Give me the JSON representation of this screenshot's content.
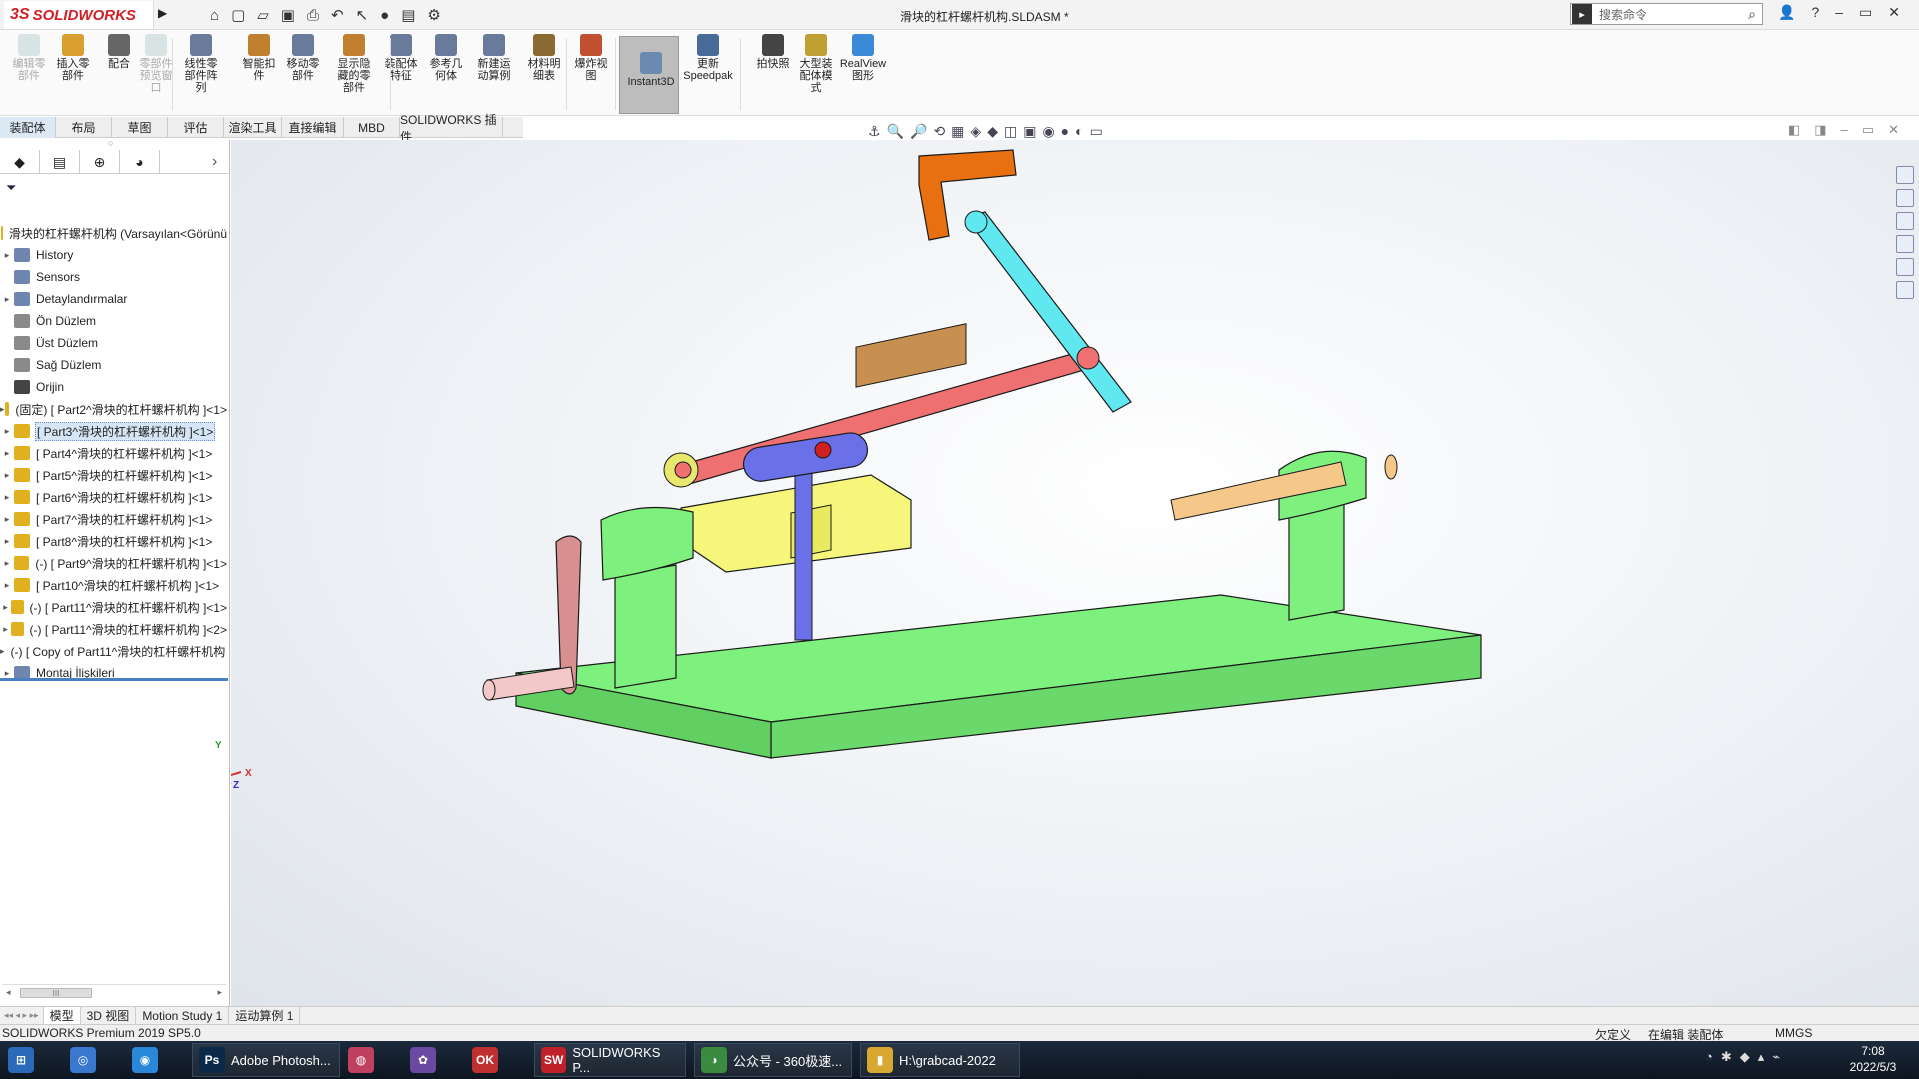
{
  "app": {
    "brand": "SOLIDWORKS",
    "brand_mark": "3S",
    "document_title": "滑块的杠杆螺杆机构.SLDASM *",
    "search_placeholder": "搜索命令",
    "qa_arrow": "▶",
    "qa_icons": [
      "⌂",
      "▢",
      "▱",
      "▣",
      "⎙",
      "↶",
      "↖",
      "●",
      "▤",
      "⚙"
    ],
    "right_icons": [
      "👤",
      "?",
      "–",
      "▭",
      "✕"
    ]
  },
  "commands": [
    {
      "label": "编辑零部件",
      "disabled": true
    },
    {
      "label": "插入零部件"
    },
    {
      "label": "配合"
    },
    {
      "label": "零部件预览窗口",
      "disabled": true
    },
    {
      "label": "线性零部件阵列"
    },
    {
      "label": "智能扣件"
    },
    {
      "label": "移动零部件"
    },
    {
      "label": "显示隐藏的零部件"
    },
    {
      "label": "装配体特征"
    },
    {
      "label": "参考几何体"
    },
    {
      "label": "新建运动算例"
    },
    {
      "label": "材料明细表"
    },
    {
      "label": "爆炸视图"
    },
    {
      "label": "Instant3D"
    },
    {
      "label": "更新Speedpak"
    },
    {
      "label": "拍快照"
    },
    {
      "label": "大型装配体模式"
    },
    {
      "label": "RealView图形"
    }
  ],
  "ribbon_tabs": [
    "装配体",
    "布局",
    "草图",
    "评估",
    "渲染工具",
    "直接编辑",
    "MBD",
    "SOLIDWORKS 插件"
  ],
  "view_icons": [
    "⚓",
    "🔍",
    "🔎",
    "⟲",
    "▦",
    "◈",
    "◆",
    "◫",
    "▣",
    "◉",
    "●",
    "◐",
    "▭"
  ],
  "window_icons": [
    "◧",
    "◨",
    "–",
    "▭",
    "✕"
  ],
  "panel": {
    "tabs": [
      "◆",
      "▤",
      "⊕",
      "◕"
    ],
    "expand": "›",
    "filter_icon": "⏷",
    "tree": [
      {
        "label": "滑块的杠杆螺杆机构  (Varsayılan<Görünü",
        "arrow": "",
        "color": "#e0b020"
      },
      {
        "label": "History",
        "arrow": "▸",
        "color": "#6e86b0"
      },
      {
        "label": "Sensors",
        "arrow": "",
        "color": "#6e86b0"
      },
      {
        "label": "Detaylandırmalar",
        "arrow": "▸",
        "color": "#6e86b0"
      },
      {
        "label": "Ön Düzlem",
        "arrow": "",
        "color": "#8a8a8a"
      },
      {
        "label": "Üst Düzlem",
        "arrow": "",
        "color": "#8a8a8a"
      },
      {
        "label": "Sağ Düzlem",
        "arrow": "",
        "color": "#8a8a8a"
      },
      {
        "label": "Orijin",
        "arrow": "",
        "color": "#444444"
      },
      {
        "label": "(固定) [ Part2^滑块的杠杆螺杆机构 ]<1>",
        "arrow": "▸",
        "color": "#e0b020"
      },
      {
        "label": "[ Part3^滑块的杠杆螺杆机构 ]<1>",
        "arrow": "▸",
        "color": "#e0b020",
        "selected": true
      },
      {
        "label": "[ Part4^滑块的杠杆螺杆机构 ]<1>",
        "arrow": "▸",
        "color": "#e0b020"
      },
      {
        "label": "[ Part5^滑块的杠杆螺杆机构 ]<1>",
        "arrow": "▸",
        "color": "#e0b020"
      },
      {
        "label": "[ Part6^滑块的杠杆螺杆机构 ]<1>",
        "arrow": "▸",
        "color": "#e0b020"
      },
      {
        "label": "[ Part7^滑块的杠杆螺杆机构 ]<1>",
        "arrow": "▸",
        "color": "#e0b020"
      },
      {
        "label": "[ Part8^滑块的杠杆螺杆机构 ]<1>",
        "arrow": "▸",
        "color": "#e0b020"
      },
      {
        "label": "(-) [ Part9^滑块的杠杆螺杆机构 ]<1>",
        "arrow": "▸",
        "color": "#e0b020"
      },
      {
        "label": "[ Part10^滑块的杠杆螺杆机构 ]<1>",
        "arrow": "▸",
        "color": "#e0b020"
      },
      {
        "label": "(-) [ Part11^滑块的杠杆螺杆机构 ]<1>",
        "arrow": "▸",
        "color": "#e0b020"
      },
      {
        "label": "(-) [ Part11^滑块的杠杆螺杆机构 ]<2>",
        "arrow": "▸",
        "color": "#e0b020"
      },
      {
        "label": "(-) [ Copy of Part11^滑块的杠杆螺杆机构 ]",
        "arrow": "▸",
        "color": "#e0b020"
      },
      {
        "label": "Montaj İlişkileri",
        "arrow": "▸",
        "color": "#6e86b0"
      }
    ],
    "scroll_label": "III"
  },
  "bottom_tabs": [
    "模型",
    "3D 视图",
    "Motion Study 1",
    "运动算例 1"
  ],
  "status": {
    "left": "SOLIDWORKS Premium 2019 SP5.0",
    "underdefined": "欠定义",
    "editing": "在编辑 装配体",
    "units": "MMGS"
  },
  "taskbar": [
    {
      "label": "",
      "icon": "⊞",
      "color": "#2a6ab8"
    },
    {
      "label": "",
      "icon": "◎",
      "color": "#3a78d0"
    },
    {
      "label": "",
      "icon": "◉",
      "color": "#2a88d8"
    },
    {
      "label": "Adobe Photosh...",
      "icon": "Ps",
      "color": "#0b2a4a"
    },
    {
      "label": "",
      "icon": "◍",
      "color": "#c04060"
    },
    {
      "label": "",
      "icon": "✿",
      "color": "#6a4aa0"
    },
    {
      "label": "",
      "icon": "OK",
      "color": "#c03030"
    },
    {
      "label": "SOLIDWORKS P...",
      "icon": "SW",
      "color": "#c0202a"
    },
    {
      "label": "公众号 - 360极速...",
      "icon": "◑",
      "color": "#3a8a40"
    },
    {
      "label": "H:\\grabcad-2022",
      "icon": "▮",
      "color": "#d8a830"
    }
  ],
  "clock": {
    "time": "7:08",
    "date": "2022/5/3"
  },
  "tray_icons": [
    "◔",
    "✱",
    "◆",
    "▴",
    "⌁"
  ],
  "triad": {
    "y": "Y",
    "x": "X",
    "z": "Z"
  },
  "colors": {
    "accent_red": "#d02027",
    "base_green": "#7ef07e",
    "lever_red": "#ee7070",
    "link_cyan": "#60e8f0",
    "slider_yellow": "#f6f67a",
    "handle_orange": "#e87010",
    "slot_blue": "#6a70e8",
    "crank_pink": "#d89090"
  }
}
